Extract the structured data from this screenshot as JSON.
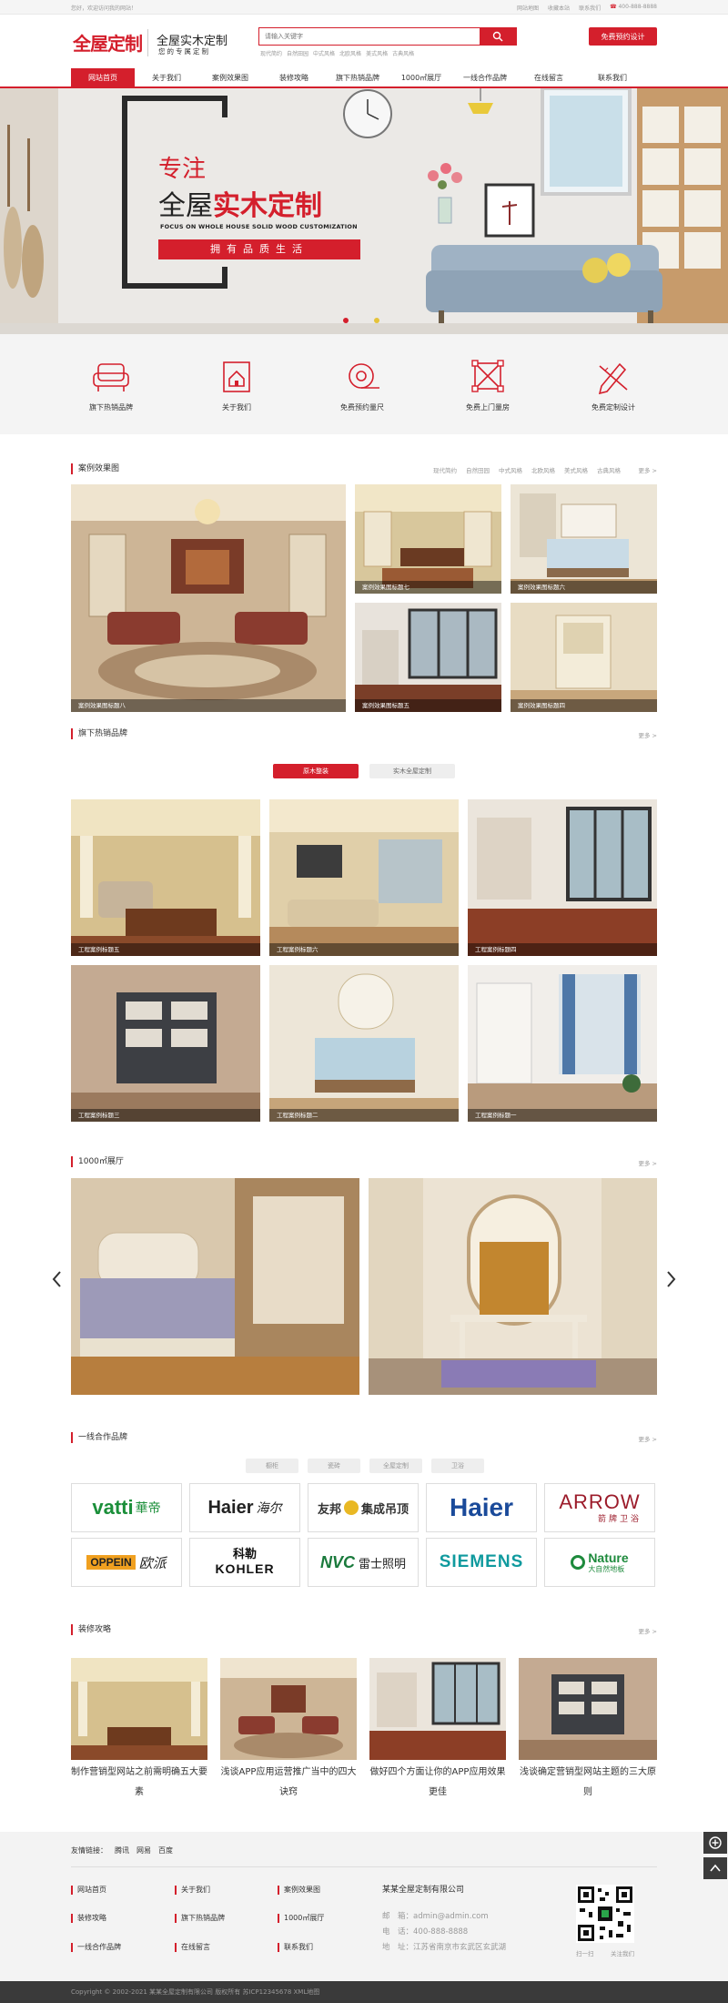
{
  "topbar": {
    "welcome": "您好，欢迎访问我的网站！",
    "links": [
      "网站地图",
      "收藏本站",
      "联系我们"
    ],
    "phone": "400-888-8888"
  },
  "header": {
    "logo_text": "全屋定制",
    "slogan_main": "全屋实木定制",
    "slogan_sub": "您的专属定制",
    "search_placeholder": "请输入关键字",
    "hot_words": [
      "现代简约",
      "自然田园",
      "中式风格",
      "北欧风格",
      "美式风格",
      "古典风格"
    ],
    "design_button": "免费预约设计"
  },
  "nav": {
    "items": [
      "网站首页",
      "关于我们",
      "案例效果图",
      "装修攻略",
      "旗下热销品牌",
      "1000㎡展厅",
      "一线合作品牌",
      "在线留言",
      "联系我们"
    ]
  },
  "banner": {
    "line1": "专注",
    "line2a": "全屋",
    "line2b": "实木定制",
    "english": "FOCUS ON WHOLE HOUSE SOLID WOOD CUSTOMIZATION",
    "button": "拥有品质生活"
  },
  "quick_links": [
    "旗下热销品牌",
    "关于我们",
    "免费预约量尺",
    "免费上门量房",
    "免费定制设计"
  ],
  "cases": {
    "title": "案例效果图",
    "tags": [
      "现代简约",
      "自然田园",
      "中式风格",
      "北欧风格",
      "美式风格",
      "古典风格"
    ],
    "more": "更多 >",
    "items": [
      "案例效果图标题八",
      "案例效果图标题七",
      "案例效果图标题六",
      "案例效果图标题五",
      "案例效果图标题四"
    ]
  },
  "brands_hot": {
    "title": "旗下热销品牌",
    "more": "更多 >",
    "tabs": [
      "原木整装",
      "实木全屋定制"
    ],
    "items": [
      "工程案例标题五",
      "工程案例标题六",
      "工程案例标题四",
      "工程案例标题三",
      "工程案例标题二",
      "工程案例标题一"
    ]
  },
  "showroom": {
    "title": "1000㎡展厅",
    "more": "更多 >"
  },
  "partners": {
    "title": "一线合作品牌",
    "more": "更多 >",
    "tabs": [
      "橱柜",
      "瓷砖",
      "全屋定制",
      "卫浴"
    ],
    "logos": [
      {
        "a": "vatti",
        "b": "華帝"
      },
      {
        "a": "Haier",
        "b": "海尔"
      },
      {
        "a": "友邦",
        "b": "集成吊顶"
      },
      {
        "a": "Haier",
        "b": ""
      },
      {
        "a": "ARROW",
        "b": "箭牌卫浴"
      },
      {
        "a": "OPPEIN",
        "b": "欧派"
      },
      {
        "a": "科勒",
        "b": "KOHLER"
      },
      {
        "a": "NVC",
        "b": "雷士照明"
      },
      {
        "a": "SIEMENS",
        "b": ""
      },
      {
        "a": "Nature",
        "b": "大自然地板"
      }
    ]
  },
  "guides": {
    "title": "装修攻略",
    "more": "更多 >",
    "items": [
      {
        "l1": "制作营销型网站之前需明确五大要",
        "l2": "素"
      },
      {
        "l1": "浅谈APP应用运营推广当中的四大",
        "l2": "诀窍"
      },
      {
        "l1": "做好四个方面让你的APP应用效果",
        "l2": "更佳"
      },
      {
        "l1": "浅谈确定营销型网站主题的三大原",
        "l2": "则"
      }
    ]
  },
  "footer": {
    "friend_label": "友情链接：",
    "friend_links": [
      "腾讯",
      "网易",
      "百度"
    ],
    "col1": [
      "网站首页",
      "装修攻略",
      "一线合作品牌"
    ],
    "col2": [
      "关于我们",
      "旗下热销品牌",
      "在线留言"
    ],
    "col3": [
      "案例效果图",
      "1000㎡展厅",
      "联系我们"
    ],
    "company": "某某全屋定制有限公司",
    "email": "邮　箱：admin@admin.com",
    "phone": "电　话：400-888-8888",
    "address": "地　址：江苏省南京市玄武区玄武湖",
    "qr_left": "扫一扫",
    "qr_right": "关注我们",
    "copyright": "Copyright © 2002-2021 某某全屋定制有限公司 版权所有  苏ICP12345678  XML地图"
  },
  "colors": {
    "brand_red": "#d41f2c",
    "footer_dark": "#3a3a3a"
  }
}
